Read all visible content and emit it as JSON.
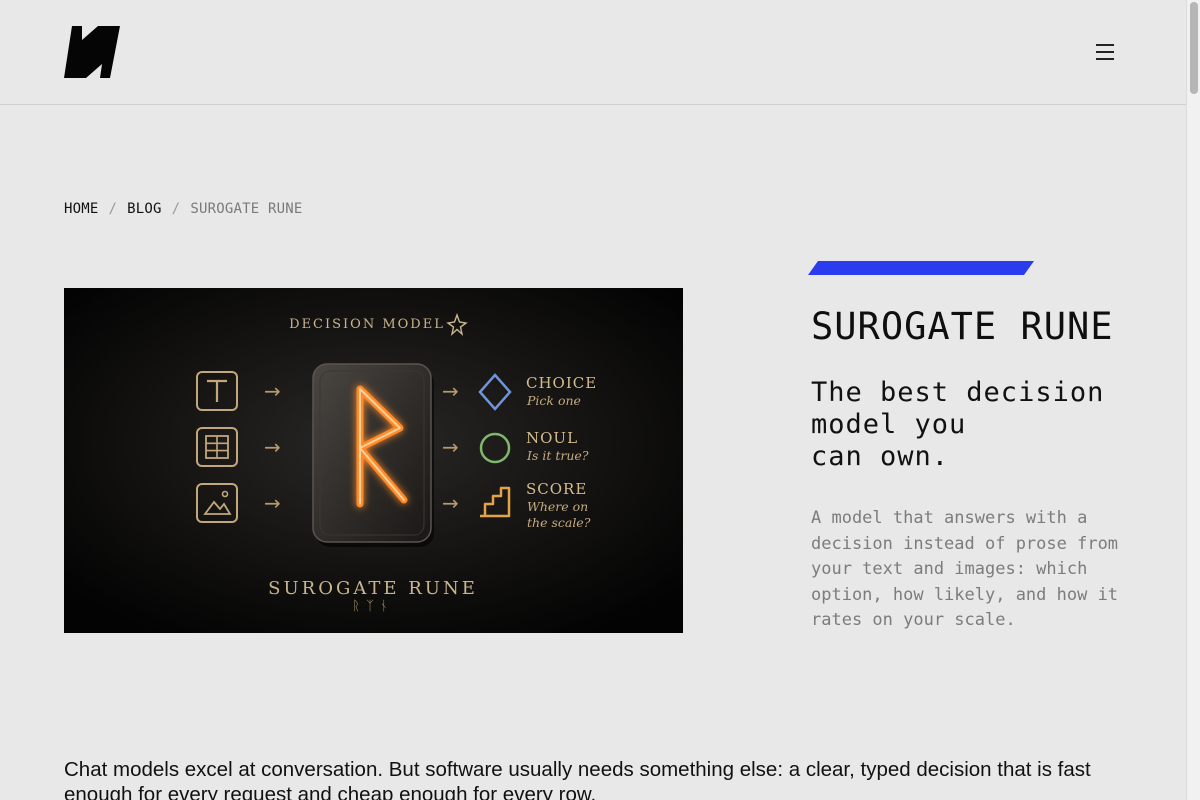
{
  "header": {
    "logo_icon": "brand-logo-icon",
    "menu_icon": "hamburger-menu-icon"
  },
  "breadcrumb": {
    "items": [
      {
        "label": "HOME"
      },
      {
        "label": "BLOG"
      },
      {
        "label": "SUROGATE RUNE"
      }
    ],
    "separator": "/"
  },
  "hero_image": {
    "heading": "DECISION MODEL",
    "rune_glyph": "R",
    "name": "SUROGATE RUNE",
    "runes": "ᚱᛉᚾ",
    "inputs": [
      "text-icon",
      "table-icon",
      "image-icon"
    ],
    "outputs": [
      {
        "label": "CHOICE",
        "sub": "Pick one",
        "icon": "diamond-icon"
      },
      {
        "label": "NOUL",
        "sub": "Is it true?",
        "icon": "circle-icon"
      },
      {
        "label": "SCORE",
        "sub": "Where on the scale?",
        "icon": "steps-icon"
      }
    ],
    "arrow": "→"
  },
  "article": {
    "title": "SUROGATE RUNE",
    "subtitle": "The best decision\nmodel you\ncan own.",
    "description": "A model that answers with a decision instead of prose from your text and images: which option, how likely, and how it rates on your scale.",
    "body": "Chat models excel at conversation. But software usually needs something else: a clear, typed decision that is fast enough for every request and cheap enough for every row."
  },
  "colors": {
    "background": "#e8e8e8",
    "accent": "#2b3cef",
    "rune_glow": "#ff8a2a",
    "gold": "#c8a978",
    "diamond": "#6f94d8",
    "circle": "#7fb86a",
    "steps": "#e3a347"
  }
}
